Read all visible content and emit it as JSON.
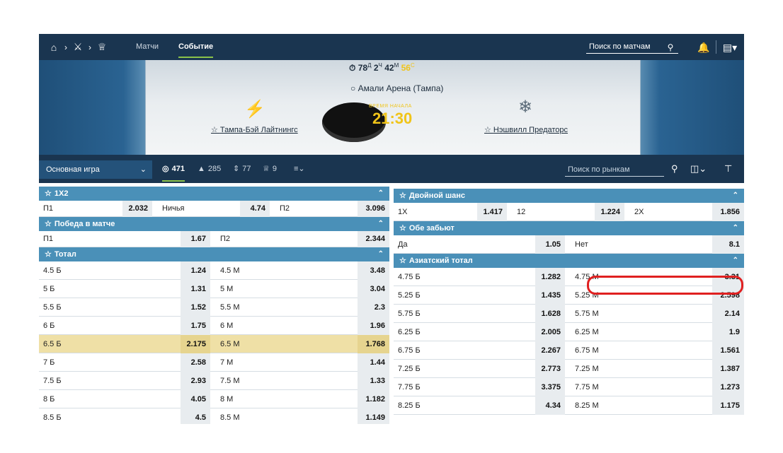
{
  "nav": {
    "links": [
      "Матчи",
      "Событие"
    ],
    "search_placeholder": "Поиск по матчам"
  },
  "event": {
    "countdown": {
      "days": "78",
      "days_u": "Д",
      "hours": "2",
      "hours_u": "Ч",
      "minutes": "42",
      "minutes_u": "М",
      "seconds": "56",
      "seconds_u": "С"
    },
    "arena": "Амали Арена (Тампа)",
    "start_label": "ВРЕМЯ НАЧАЛА",
    "start_time": "21:30",
    "home_team": "Тампа-Бэй Лайтнингс",
    "away_team": "Нэшвилл Предаторс"
  },
  "market_bar": {
    "game_select": "Основная игра",
    "stats": [
      "471",
      "285",
      "77",
      "9"
    ],
    "search_placeholder": "Поиск по рынкам"
  },
  "left": {
    "s1x2": {
      "title": "1X2",
      "cells": [
        "П1",
        "2.032",
        "Ничья",
        "4.74",
        "П2",
        "3.096"
      ]
    },
    "win": {
      "title": "Победа в матче",
      "cells": [
        "П1",
        "1.67",
        "П2",
        "2.344"
      ]
    },
    "total": {
      "title": "Тотал",
      "rows": [
        [
          "4.5 Б",
          "1.24",
          "4.5 М",
          "3.48"
        ],
        [
          "5 Б",
          "1.31",
          "5 М",
          "3.04"
        ],
        [
          "5.5 Б",
          "1.52",
          "5.5 М",
          "2.3"
        ],
        [
          "6 Б",
          "1.75",
          "6 М",
          "1.96"
        ],
        [
          "6.5 Б",
          "2.175",
          "6.5 М",
          "1.768"
        ],
        [
          "7 Б",
          "2.58",
          "7 М",
          "1.44"
        ],
        [
          "7.5 Б",
          "2.93",
          "7.5 М",
          "1.33"
        ],
        [
          "8 Б",
          "4.05",
          "8 М",
          "1.182"
        ],
        [
          "8.5 Б",
          "4.5",
          "8.5 М",
          "1.149"
        ]
      ]
    }
  },
  "right": {
    "double": {
      "title": "Двойной шанс",
      "cells": [
        "1X",
        "1.417",
        "12",
        "1.224",
        "2X",
        "1.856"
      ]
    },
    "both": {
      "title": "Обе забьют",
      "cells": [
        "Да",
        "1.05",
        "Нет",
        "8.1"
      ]
    },
    "asian": {
      "title": "Азиатский тотал",
      "rows": [
        [
          "4.75 Б",
          "1.282",
          "4.75 М",
          "3.31"
        ],
        [
          "5.25 Б",
          "1.435",
          "5.25 М",
          "2.598"
        ],
        [
          "5.75 Б",
          "1.628",
          "5.75 М",
          "2.14"
        ],
        [
          "6.25 Б",
          "2.005",
          "6.25 М",
          "1.9"
        ],
        [
          "6.75 Б",
          "2.267",
          "6.75 М",
          "1.561"
        ],
        [
          "7.25 Б",
          "2.773",
          "7.25 М",
          "1.387"
        ],
        [
          "7.75 Б",
          "3.375",
          "7.75 М",
          "1.273"
        ],
        [
          "8.25 Б",
          "4.34",
          "8.25 М",
          "1.175"
        ]
      ]
    }
  }
}
